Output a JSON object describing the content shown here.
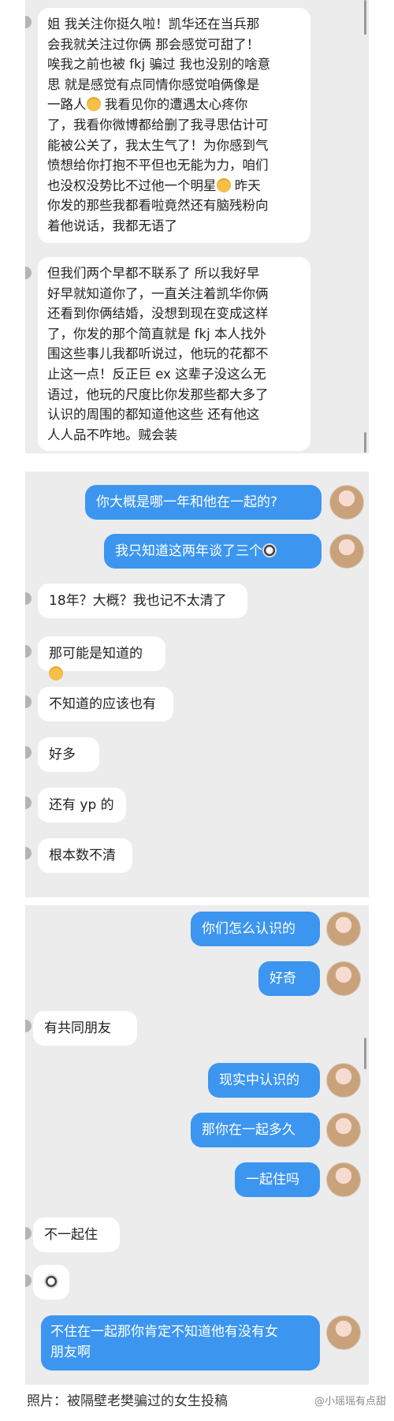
{
  "panel1": {
    "msg1": {
      "l1": "姐 我关注你挺久啦！凯华还在当兵那",
      "l2": "会我就关注过你俩 那会感觉可甜了！",
      "l3": "唉我之前也被 fkj 骗过 我也没别的啥意",
      "l4": "思 就是感觉有点同情你感觉咱俩像是",
      "l5a": "一路人",
      "l5b": " 我看见你的遭遇太心疼你",
      "l6": "了，我看你微博都给删了我寻思估计可",
      "l7": "能被公关了，我太生气了！为你感到气",
      "l8": "愤想给你打抱不平但也无能为力，咱们",
      "l9a": "也没权没势比不过他一个明星",
      "l9b": " 昨天",
      "l10": "你发的那些我都看啦竟然还有脑残粉向",
      "l11": "着他说话，我都无语了"
    },
    "msg2": {
      "l1": "但我们两个早都不联系了 所以我好早",
      "l2": "好早就知道你了，一直关注着凯华你俩",
      "l3": "还看到你俩结婚，没想到现在变成这样",
      "l4": "了，你发的那个简直就是 fkj 本人找外",
      "l5": "围这些事儿我都听说过，他玩的花都不",
      "l6": "止这一点！反正巨 ex 这辈子没这么无",
      "l7": "语过，他玩的尺度比你发那些都大多了",
      "l8": "认识的周围的都知道他这些 还有他这",
      "l9": "人人品不咋地。贼会装"
    }
  },
  "panel2": {
    "out1": "你大概是哪一年和他在一起的?",
    "out2": "我只知道这两年谈了三个",
    "in1": "18年？大概？我也记不太清了",
    "in2": "那可能是知道的",
    "in3": "不知道的应该也有",
    "in4": "好多",
    "in5": "还有 yp 的",
    "in6": "根本数不清"
  },
  "panel3": {
    "out1": "你们怎么认识的",
    "out2": "好奇",
    "in1": "有共同朋友",
    "out3": "现实中认识的",
    "out4": "那你在一起多久",
    "out5": "一起住吗",
    "in2": "不一起住",
    "out6a": "不住在一起那你肯定不知道他有没有女",
    "out6b": "朋友啊"
  },
  "caption": "照片：被隔壁老樊骗过的女生投稿",
  "watermark": "@小瑶瑶有点甜",
  "colors": {
    "blue_bubble": "#3c96f0",
    "panel_bg": "#ececec"
  }
}
